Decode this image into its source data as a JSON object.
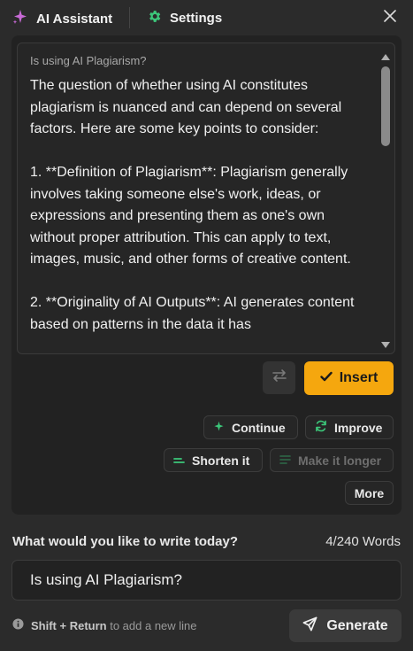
{
  "header": {
    "ai_tab_label": "AI Assistant",
    "settings_tab_label": "Settings"
  },
  "response": {
    "query": "Is using AI Plagiarism?",
    "text": "The question of whether using AI constitutes plagiarism is nuanced and can depend on several factors. Here are some key points to consider:\n\n1. **Definition of Plagiarism**: Plagiarism generally involves taking someone else's work, ideas, or expressions and presenting them as one's own without proper attribution. This can apply to text, images, music, and other forms of creative content.\n\n2. **Originality of AI Outputs**: AI generates content based on patterns in the data it has"
  },
  "actions": {
    "insert_label": "Insert",
    "continue_label": "Continue",
    "improve_label": "Improve",
    "shorten_label": "Shorten it",
    "longer_label": "Make it longer",
    "more_label": "More"
  },
  "prompt": {
    "label": "What would you like to write today?",
    "word_count": "4/240 Words",
    "value": "Is using AI Plagiarism?"
  },
  "hint": {
    "keys": "Shift + Return",
    "text": "to add a new line"
  },
  "generate_label": "Generate",
  "colors": {
    "accent": "#f5a70e",
    "ai_icon": "#c86ad6",
    "green": "#3cc77a"
  }
}
